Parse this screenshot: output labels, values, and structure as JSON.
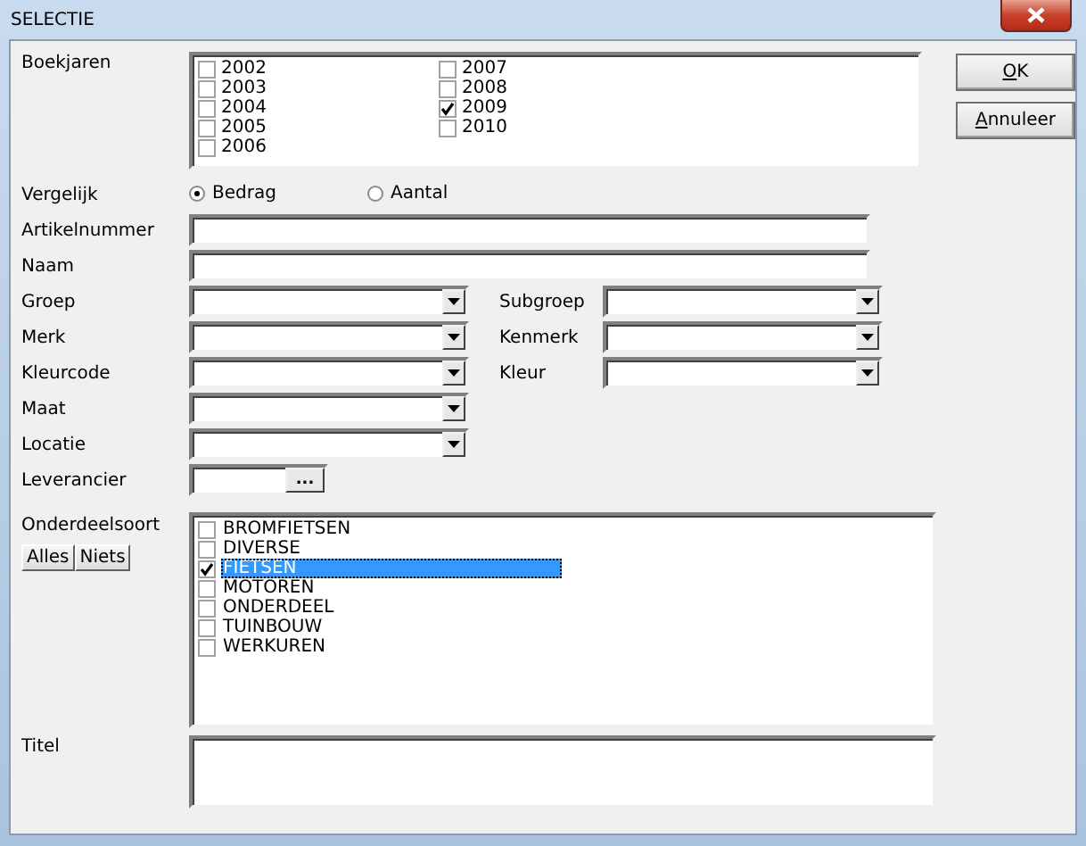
{
  "window": {
    "title": "SELECTIE"
  },
  "boekjaren": {
    "label": "Boekjaren",
    "items": [
      {
        "label": "2002",
        "checked": false
      },
      {
        "label": "2003",
        "checked": false
      },
      {
        "label": "2004",
        "checked": false
      },
      {
        "label": "2005",
        "checked": false
      },
      {
        "label": "2006",
        "checked": false
      },
      {
        "label": "2007",
        "checked": false
      },
      {
        "label": "2008",
        "checked": false
      },
      {
        "label": "2009",
        "checked": true
      },
      {
        "label": "2010",
        "checked": false
      }
    ]
  },
  "buttons": [
    {
      "underlined": "O",
      "rest": "K"
    },
    {
      "underlined": "A",
      "rest": "nnuleer"
    }
  ],
  "vergelijk": {
    "label": "Vergelijk",
    "options": [
      {
        "label": "Bedrag",
        "selected": true
      },
      {
        "label": "Aantal",
        "selected": false
      }
    ]
  },
  "rows": [
    {
      "fields": [
        {
          "kind": "text",
          "label": "Artikelnummer"
        }
      ]
    },
    {
      "fields": [
        {
          "kind": "text",
          "label": "Naam"
        }
      ]
    },
    {
      "fields": [
        {
          "kind": "combo",
          "label": "Groep"
        },
        {
          "kind": "combo",
          "label": "Subgroep"
        }
      ]
    },
    {
      "fields": [
        {
          "kind": "combo",
          "label": "Merk"
        },
        {
          "kind": "combo",
          "label": "Kenmerk"
        }
      ]
    },
    {
      "fields": [
        {
          "kind": "combo",
          "label": "Kleurcode"
        },
        {
          "kind": "combo",
          "label": "Kleur"
        }
      ]
    },
    {
      "fields": [
        {
          "kind": "combo",
          "label": "Maat"
        }
      ]
    },
    {
      "fields": [
        {
          "kind": "combo",
          "label": "Locatie"
        }
      ]
    },
    {
      "fields": [
        {
          "kind": "lookup",
          "label": "Leverancier",
          "button": "..."
        }
      ]
    }
  ],
  "onderdeelsoort": {
    "label": "Onderdeelsoort",
    "buttons": [
      "Alles",
      "Niets"
    ],
    "items": [
      {
        "label": "BROMFIETSEN",
        "checked": false,
        "selected": false
      },
      {
        "label": "DIVERSE",
        "checked": false,
        "selected": false
      },
      {
        "label": "FIETSEN",
        "checked": true,
        "selected": true
      },
      {
        "label": "MOTOREN",
        "checked": false,
        "selected": false
      },
      {
        "label": "ONDERDEEL",
        "checked": false,
        "selected": false
      },
      {
        "label": "TUINBOUW",
        "checked": false,
        "selected": false
      },
      {
        "label": "WERKUREN",
        "checked": false,
        "selected": false
      }
    ]
  },
  "titel": {
    "label": "Titel"
  }
}
